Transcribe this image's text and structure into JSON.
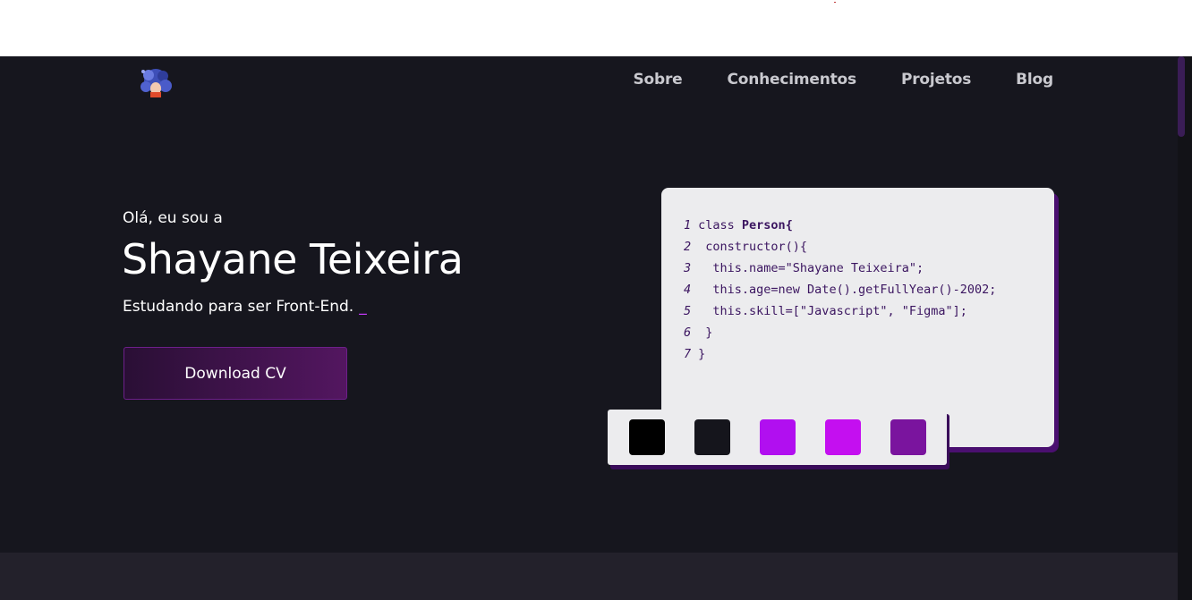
{
  "nav": {
    "items": [
      {
        "label": "Sobre"
      },
      {
        "label": "Conhecimentos"
      },
      {
        "label": "Projetos"
      },
      {
        "label": "Blog"
      }
    ]
  },
  "hero": {
    "greeting": "Olá, eu sou a",
    "name": "Shayane Teixeira",
    "role": "Estudando para ser Front-End.",
    "cursor": "_",
    "cv_button": "Download CV"
  },
  "code": {
    "lines": [
      {
        "num": "1",
        "text": "class ",
        "bold": "Person{"
      },
      {
        "num": "2",
        "text": " constructor(){",
        "bold": ""
      },
      {
        "num": "3",
        "text": "  this.name=\"Shayane Teixeira\";",
        "bold": ""
      },
      {
        "num": "4",
        "text": "  this.age=new Date().getFullYear()-2002;",
        "bold": ""
      },
      {
        "num": "5",
        "text": "  this.skill=[\"Javascript\", \"Figma\"];",
        "bold": ""
      },
      {
        "num": "6",
        "text": " }",
        "bold": ""
      },
      {
        "num": "7",
        "text": "}",
        "bold": ""
      }
    ]
  },
  "palette": {
    "colors": [
      "#000000",
      "#15151c",
      "#b10ff0",
      "#c40ff0",
      "#7a149e"
    ]
  }
}
